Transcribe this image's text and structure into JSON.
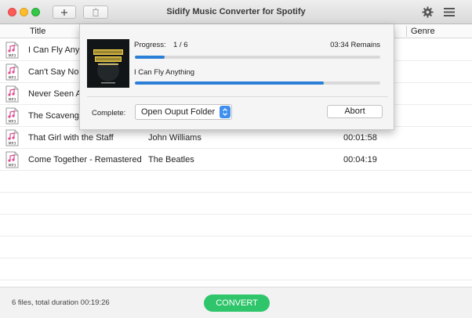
{
  "window": {
    "title": "Sidify Music Converter for Spotify"
  },
  "toolbar": {
    "add_icon": "plus-icon",
    "delete_icon": "trash-icon",
    "settings_icon": "gear-icon",
    "menu_icon": "hamburger-menu-icon"
  },
  "table": {
    "headers": {
      "title": "Title",
      "genre": "Genre"
    },
    "rows": [
      {
        "icon": "MP3",
        "title": "I Can Fly Any",
        "artist": "",
        "duration": ""
      },
      {
        "icon": "MP3",
        "title": "Can't Say No",
        "artist": "",
        "duration": ""
      },
      {
        "icon": "MP3",
        "title": "Never Seen A",
        "artist": "",
        "duration": ""
      },
      {
        "icon": "MP3",
        "title": "The Scavenge",
        "artist": "",
        "duration": ""
      },
      {
        "icon": "MP3",
        "title": "That Girl with the Staff",
        "artist": "John Williams",
        "duration": "00:01:58"
      },
      {
        "icon": "MP3",
        "title": "Come Together - Remastered",
        "artist": "The Beatles",
        "duration": "00:04:19"
      }
    ]
  },
  "dialog": {
    "progress_label": "Progress:",
    "progress_count": "1 / 6",
    "remains": "03:34 Remains",
    "overall_progress": 0.12,
    "current_track": "I Can Fly Anything",
    "track_progress": 0.77,
    "complete_label": "Complete:",
    "complete_option": "Open Ouput Folder",
    "abort_label": "Abort",
    "cover_art": "star-wars-album-cover"
  },
  "footer": {
    "summary": "6 files, total duration 00:19:26",
    "convert_label": "CONVERT"
  },
  "colors": {
    "accent_green": "#2fc56b",
    "progress_blue": "#2b7fd6",
    "select_blue": "#3d8ff0"
  }
}
